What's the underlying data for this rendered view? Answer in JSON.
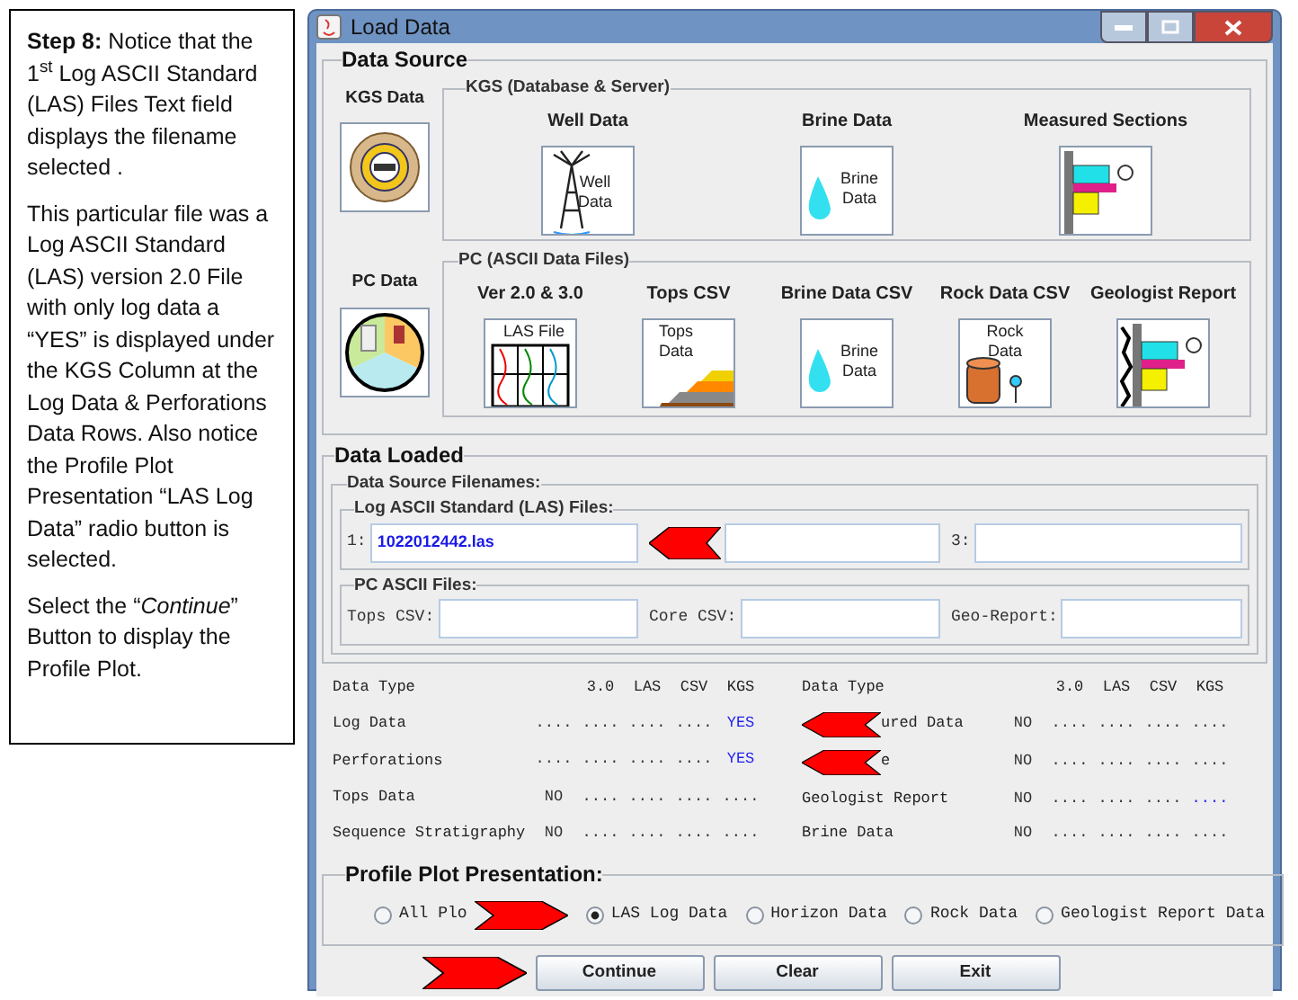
{
  "instructions": [
    "**Step 8:** Notice that the 1$^{st}$ Log ASCII Standard (LAS) Files Text field displays the filename selected .",
    "This particular file was a Log ASCII Standard (LAS) version 2.0 File with  only log data a “YES”  is displayed under the KGS Column at  the Log Data & Perforations Data Rows.  Also notice the Profile Plot Presentation “LAS Log Data” radio button is selected.",
    "Select the “*Continue*” Button to display the Profile Plot."
  ],
  "window": {
    "title": "Load Data"
  },
  "data_source": {
    "title": "Data Source",
    "kgs": {
      "label": "KGS Data",
      "group": "KGS (Database & Server)",
      "items": [
        {
          "kind": "well",
          "label": "Well Data",
          "image_text": "Well Data"
        },
        {
          "kind": "brine",
          "label": "Brine Data",
          "image_text": "Brine Data"
        },
        {
          "kind": "section",
          "label": "Measured Sections"
        }
      ]
    },
    "pc": {
      "label": "PC Data",
      "group": "PC (ASCII Data Files)",
      "items": [
        {
          "kind": "las",
          "label": "Ver 2.0 & 3.0",
          "image_text": "LAS File"
        },
        {
          "kind": "tops",
          "label": "Tops CSV",
          "image_text": "Tops Data"
        },
        {
          "kind": "brine",
          "label": "Brine Data CSV",
          "image_text": "Brine Data"
        },
        {
          "kind": "rock",
          "label": "Rock Data CSV",
          "image_text": "Rock Data"
        },
        {
          "kind": "report",
          "label": "Geologist Report"
        }
      ]
    }
  },
  "data_loaded": {
    "title": "Data Loaded",
    "filenames_title": "Data Source Filenames:",
    "las": {
      "title": "Log ASCII Standard (LAS) Files:",
      "fields": [
        {
          "label": "1:",
          "value": "1022012442.las",
          "covered": false
        },
        {
          "covered": true
        },
        {
          "label": "3:",
          "covered": false
        }
      ]
    },
    "pc": {
      "title": "PC ASCII Files:",
      "fields": [
        {
          "label": "Tops CSV:"
        },
        {
          "label": "Core CSV:"
        },
        {
          "label": "Geo-Report:"
        }
      ]
    }
  },
  "table": {
    "left_columns": [
      "Data Type",
      "3.0",
      "LAS",
      "CSV",
      "KGS"
    ],
    "right_columns": [
      "Data Type",
      "3.0",
      "LAS",
      "CSV",
      "KGS"
    ],
    "left": [
      {
        "label": "Log Data",
        "covered": false,
        "cells": [
          {
            "text": "....",
            "highlight": false
          },
          {
            "text": "....",
            "highlight": false
          },
          {
            "text": "....",
            "highlight": false
          },
          {
            "text": "....",
            "highlight": false
          },
          {
            "text": "YES",
            "highlight": true
          }
        ]
      },
      {
        "label": "Perforations",
        "covered": false,
        "cells": [
          {
            "text": "....",
            "highlight": false
          },
          {
            "text": "....",
            "highlight": false
          },
          {
            "text": "....",
            "highlight": false
          },
          {
            "text": "....",
            "highlight": false
          },
          {
            "text": "YES",
            "highlight": true
          }
        ]
      },
      {
        "label": "Tops Data",
        "covered": false,
        "cells": [
          {
            "text": "NO",
            "highlight": false
          },
          {
            "text": "....",
            "highlight": false
          },
          {
            "text": "....",
            "highlight": false
          },
          {
            "text": "....",
            "highlight": false
          },
          {
            "text": "....",
            "highlight": false
          }
        ]
      },
      {
        "label": "Sequence Stratigraphy",
        "covered": false,
        "cells": [
          {
            "text": "NO",
            "highlight": false
          },
          {
            "text": "....",
            "highlight": false
          },
          {
            "text": "....",
            "highlight": false
          },
          {
            "text": "....",
            "highlight": false
          },
          {
            "text": "....",
            "highlight": false
          }
        ]
      }
    ],
    "right": [
      {
        "label": "ured Data",
        "covered": true,
        "cells": [
          {
            "text": "NO",
            "highlight": false
          },
          {
            "text": "....",
            "highlight": false
          },
          {
            "text": "....",
            "highlight": false
          },
          {
            "text": "....",
            "highlight": false
          },
          {
            "text": "....",
            "highlight": false
          }
        ]
      },
      {
        "label": "e",
        "covered": true,
        "cells": [
          {
            "text": "NO",
            "highlight": false
          },
          {
            "text": "....",
            "highlight": false
          },
          {
            "text": "....",
            "highlight": false
          },
          {
            "text": "....",
            "highlight": false
          },
          {
            "text": "....",
            "highlight": false
          }
        ]
      },
      {
        "label": "Geologist Report",
        "covered": false,
        "cells": [
          {
            "text": "NO",
            "highlight": false
          },
          {
            "text": "....",
            "highlight": false
          },
          {
            "text": "....",
            "highlight": false
          },
          {
            "text": "....",
            "highlight": false
          },
          {
            "text": "....",
            "highlight": true
          }
        ]
      },
      {
        "label": "Brine Data",
        "covered": false,
        "cells": [
          {
            "text": "NO",
            "highlight": false
          },
          {
            "text": "....",
            "highlight": false
          },
          {
            "text": "....",
            "highlight": false
          },
          {
            "text": "....",
            "highlight": false
          },
          {
            "text": "....",
            "highlight": false
          }
        ]
      }
    ]
  },
  "profile": {
    "title": "Profile Plot Presentation:",
    "options": [
      {
        "label": "All Plo",
        "selected": false,
        "covered": true
      },
      {
        "label": "LAS Log Data",
        "selected": true,
        "covered": false
      },
      {
        "label": "Horizon Data",
        "selected": false,
        "covered": false
      },
      {
        "label": "Rock Data",
        "selected": false,
        "covered": false
      },
      {
        "label": "Geologist Report Data",
        "selected": false,
        "covered": false
      }
    ]
  },
  "buttons": [
    {
      "label": "Continue",
      "pointed": true
    },
    {
      "label": "Clear",
      "pointed": false
    },
    {
      "label": "Exit",
      "pointed": false
    }
  ]
}
